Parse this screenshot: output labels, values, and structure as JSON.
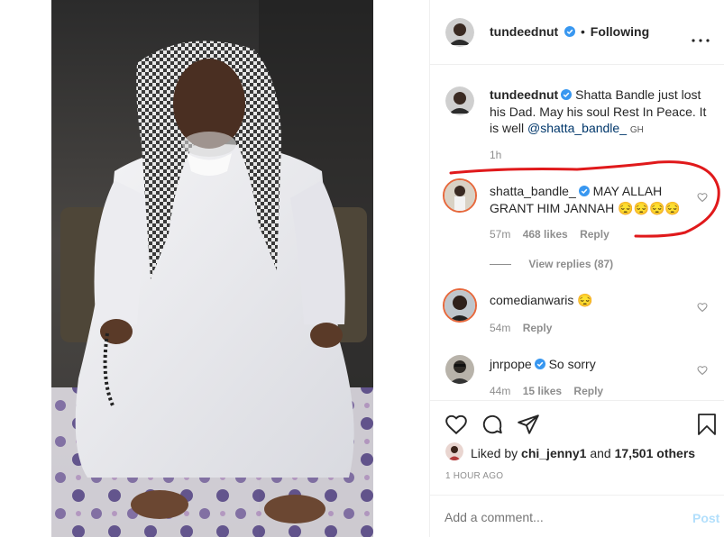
{
  "post_author": {
    "username": "tundeednut",
    "follow_status": "Following"
  },
  "caption": {
    "username": "tundeednut",
    "text": "Shatta Bandle just lost his Dad. May his soul Rest In Peace. It is well",
    "mention": "@shatta_bandle_",
    "location_tag": "GH",
    "time": "1h"
  },
  "comments": [
    {
      "username": "shatta_bandle_",
      "verified": true,
      "text": "MAY ALLAH GRANT HIM JANNAH 😔😔😔😔",
      "time": "57m",
      "likes": "468 likes",
      "reply_label": "Reply",
      "view_replies": "View replies (87)"
    },
    {
      "username": "comedianwaris",
      "verified": false,
      "text": "😔",
      "time": "54m",
      "reply_label": "Reply"
    },
    {
      "username": "jnrpope",
      "verified": true,
      "text": "So sorry",
      "time": "44m",
      "likes": "15 likes",
      "reply_label": "Reply"
    }
  ],
  "likes_summary": {
    "prefix": "Liked by",
    "user": "chi_jenny1",
    "joiner": "and",
    "others": "17,501 others"
  },
  "timestamp": "1 HOUR AGO",
  "comment_box": {
    "placeholder": "Add a comment...",
    "post_label": "Post"
  },
  "colors": {
    "verified_blue": "#3897f0",
    "annotation_red": "#e0191b",
    "post_disabled": "#b2dffc"
  },
  "icons": [
    "verified-icon",
    "more-options-icon",
    "heart-icon",
    "comment-icon",
    "share-icon",
    "bookmark-icon"
  ]
}
